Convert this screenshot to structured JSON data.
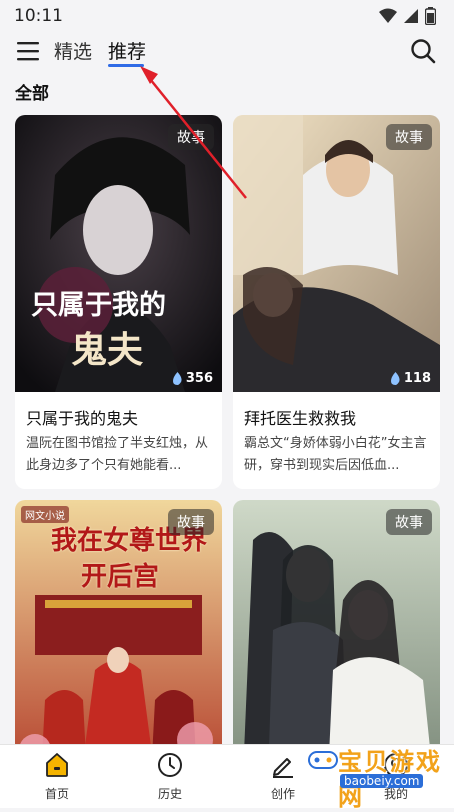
{
  "status_bar": {
    "time": "10:11"
  },
  "top_nav": {
    "tabs": [
      {
        "label": "精选",
        "active": false
      },
      {
        "label": "推荐",
        "active": true
      }
    ]
  },
  "section": {
    "title": "全部"
  },
  "cards": [
    {
      "badge": "故事",
      "title": "只属于我的鬼夫",
      "desc": "温阮在图书馆捡了半支红烛，从此身边多了个只有她能看...",
      "likes": "356",
      "cover_text": [
        "只属于我的",
        "鬼夫"
      ]
    },
    {
      "badge": "故事",
      "title": "拜托医生救救我",
      "desc": "霸总文“身娇体弱小白花”女主言研，穿书到现实后因低血...",
      "likes": "118"
    },
    {
      "badge": "故事",
      "cover_logo": "网文小说",
      "cover_text": [
        "我在女尊世界",
        "开后宫"
      ]
    },
    {
      "badge": "故事"
    }
  ],
  "bottom_nav": {
    "items": [
      {
        "label": "首页",
        "icon": "home-icon",
        "active": true
      },
      {
        "label": "历史",
        "icon": "clock-icon"
      },
      {
        "label": "创作",
        "icon": "pen-icon"
      },
      {
        "label": "我的",
        "icon": "profile-icon"
      }
    ]
  },
  "watermark": {
    "text": "宝贝游戏网",
    "url": "baobeiy.com"
  },
  "colors": {
    "accent": "#2f6be6",
    "home_active": "#f5b400",
    "arrow": "#e0202a"
  }
}
